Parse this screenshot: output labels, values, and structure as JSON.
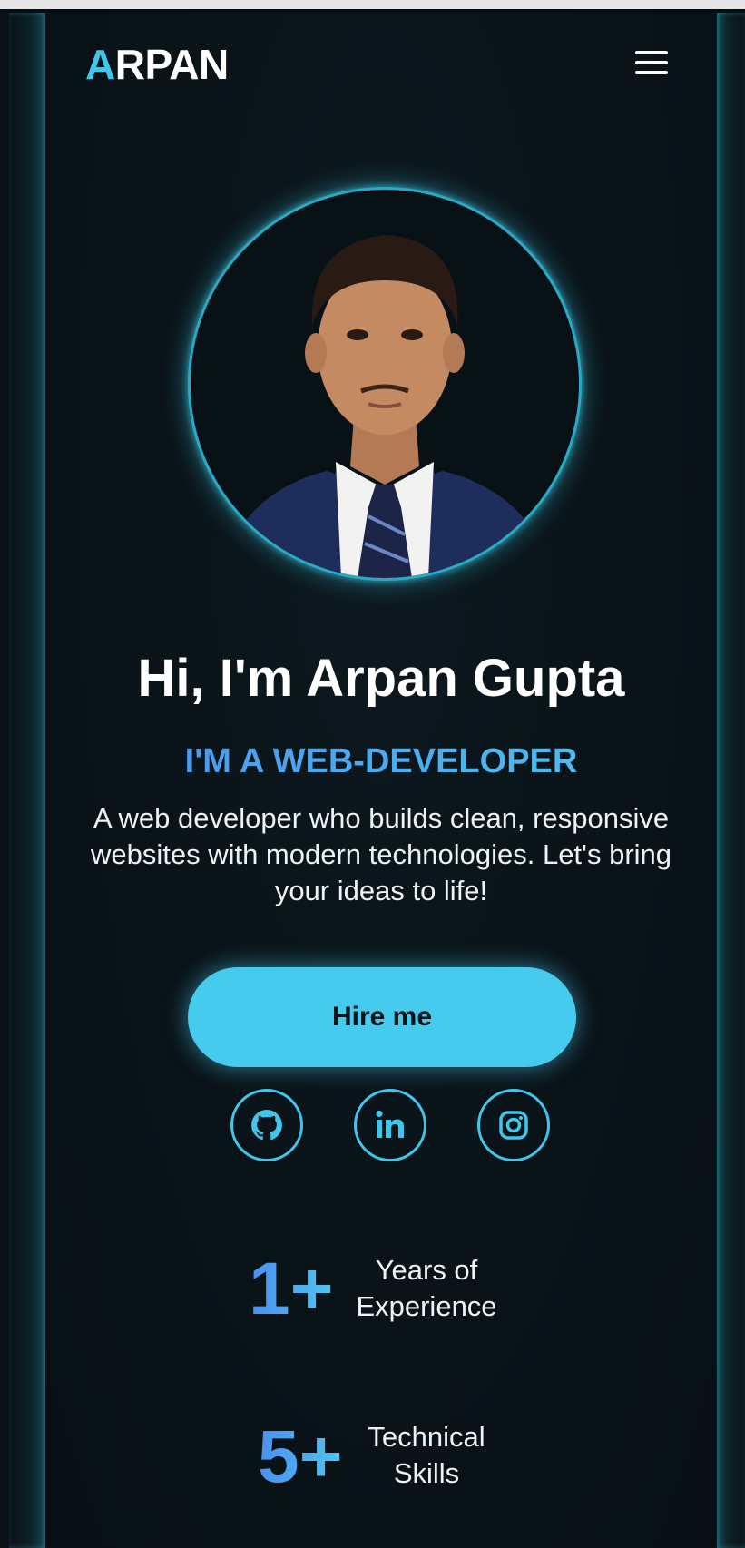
{
  "brand": {
    "first_letter": "A",
    "rest": "RPAN"
  },
  "nav": {
    "menu_icon": "hamburger-menu-icon"
  },
  "hero": {
    "title": "Hi, I'm Arpan Gupta",
    "subtitle": "I'M A WEB-DEVELOPER",
    "description": "A web developer who builds clean, responsive websites with modern technologies. Let's bring your ideas to life!",
    "cta_label": "Hire me"
  },
  "social": [
    {
      "icon": "github-icon"
    },
    {
      "icon": "linkedin-icon"
    },
    {
      "icon": "instagram-icon"
    }
  ],
  "stats": [
    {
      "value": "1+",
      "label_line1": "Years of",
      "label_line2": "Experience"
    },
    {
      "value": "5+",
      "label_line1": "Technical",
      "label_line2": "Skills"
    }
  ],
  "colors": {
    "accent": "#40c6ea",
    "gradient_start": "#4a8ff0",
    "background": "#0a1116",
    "text": "#ffffff"
  }
}
